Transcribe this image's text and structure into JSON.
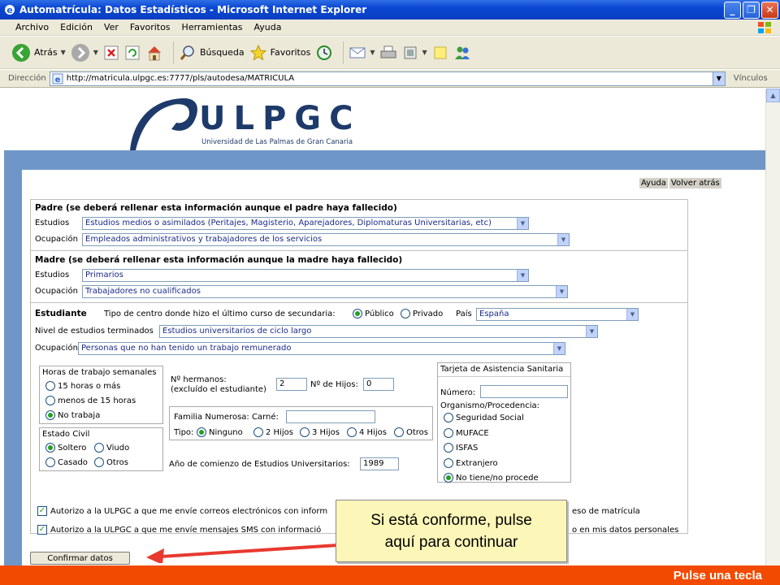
{
  "window": {
    "title": "Automatrícula: Datos Estadísticos - Microsoft Internet Explorer"
  },
  "menu": [
    "Archivo",
    "Edición",
    "Ver",
    "Favoritos",
    "Herramientas",
    "Ayuda"
  ],
  "toolbar": {
    "back_label": "Atrás",
    "search_label": "Búsqueda",
    "favorites_label": "Favoritos"
  },
  "address": {
    "label": "Dirección",
    "url": "http://matricula.ulpgc.es:7777/pls/autodesa/MATRICULA",
    "links_label": "Vínculos"
  },
  "logo": {
    "letters": "ULPGC",
    "subtitle": "Universidad de Las Palmas de Gran Canaria"
  },
  "top_links": {
    "help": "Ayuda",
    "back": "Volver atrás"
  },
  "father": {
    "title": "Padre (se deberá rellenar esta información aunque el padre haya fallecido)",
    "studies_label": "Estudios",
    "studies_value": "Estudios medios o asimilados (Peritajes, Magisterio, Aparejadores, Diplomaturas Universitarias, etc)",
    "occupation_label": "Ocupación",
    "occupation_value": "Empleados administrativos y trabajadores de los servicios"
  },
  "mother": {
    "title": "Madre (se deberá rellenar esta información aunque la madre haya fallecido)",
    "studies_label": "Estudios",
    "studies_value": "Primarios",
    "occupation_label": "Ocupación",
    "occupation_value": "Trabajadores no cualificados"
  },
  "student": {
    "title": "Estudiante",
    "center_type_label": "Tipo de centro donde hizo el último curso de secundaria:",
    "center_public": "Público",
    "center_private": "Privado",
    "country_label": "País",
    "country_value": "España",
    "level_label": "Nivel de estudios terminados",
    "level_value": "Estudios universitarios de ciclo largo",
    "occupation_label": "Ocupación",
    "occupation_value": "Personas que no han tenido un trabajo remunerado",
    "work_hours_title": "Horas de trabajo semanales",
    "work_hours_options": [
      "15 horas o más",
      "menos de 15 horas",
      "No trabaja"
    ],
    "civil_title": "Estado Civil",
    "civil_options": [
      "Soltero",
      "Viudo",
      "Casado",
      "Otros"
    ],
    "siblings_label_1": "Nº hermanos:",
    "siblings_label_2": "(excluído el estudiante)",
    "siblings_value": "2",
    "children_label": "Nº de Hijos:",
    "children_value": "0",
    "large_family_label": "Familia Numerosa: Carné:",
    "large_family_card": "",
    "type_label": "Tipo:",
    "type_options": [
      "Ninguno",
      "2 Hijos",
      "3 Hijos",
      "4 Hijos",
      "Otros"
    ],
    "start_year_label": "Año de comienzo de Estudios Universitarios:",
    "start_year_value": "1989"
  },
  "health_card": {
    "title": "Tarjeta de Asistencia Sanitaria",
    "number_label": "Número:",
    "number_value": "",
    "organism_label": "Organismo/Procedencia:",
    "options": [
      "Seguridad Social",
      "MUFACE",
      "ISFAS",
      "Extranjero",
      "No tiene/no procede"
    ]
  },
  "consents": {
    "email_start": "Autorizo a la ULPGC a que me envíe correos electrónicos con inform",
    "email_end": "eso de matrícula",
    "sms_start": "Autorizo a la ULPGC a que me envíe mensajes SMS con informació",
    "sms_end": "o en mis datos personales"
  },
  "confirm_button": "Confirmar datos",
  "tooltip": {
    "line1": "Si está conforme, pulse",
    "line2": "aquí para continuar"
  },
  "status": {
    "text": "Pulse una tecla"
  },
  "colors": {
    "status_bar": "#f24a00",
    "tooltip_bg": "#fcf6b8",
    "blue_band": "#6e97c8",
    "arrow": "#e8392f"
  }
}
